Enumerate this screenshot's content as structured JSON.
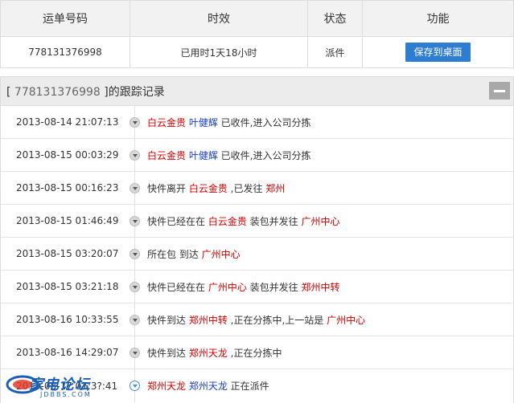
{
  "summary": {
    "headers": [
      "运单号码",
      "时效",
      "状态",
      "功能"
    ],
    "tracking_number": "778131376998",
    "duration": "已用时1天18小时",
    "status": "派件",
    "save_label": "保存到桌面"
  },
  "panel": {
    "title_prefix": "[ ",
    "tracking_number": "778131376998",
    "title_suffix": " ]的跟踪记录"
  },
  "events": [
    {
      "time": "2013-08-14 21:07:13",
      "parts": [
        [
          "red",
          "白云金贵"
        ],
        [
          "blue",
          " 叶健辉"
        ],
        [
          "plain",
          " 已收件,进入公司分拣"
        ]
      ]
    },
    {
      "time": "2013-08-15 00:03:29",
      "parts": [
        [
          "red",
          "白云金贵"
        ],
        [
          "blue",
          " 叶健辉"
        ],
        [
          "plain",
          " 已收件,进入公司分拣"
        ]
      ]
    },
    {
      "time": "2013-08-15 00:16:23",
      "parts": [
        [
          "plain",
          "快件离开 "
        ],
        [
          "red",
          "白云金贵"
        ],
        [
          "plain",
          " ,已发往 "
        ],
        [
          "red",
          "郑州"
        ]
      ]
    },
    {
      "time": "2013-08-15 01:46:49",
      "parts": [
        [
          "plain",
          "快件已经在在 "
        ],
        [
          "red",
          "白云金贵"
        ],
        [
          "plain",
          " 装包并发往 "
        ],
        [
          "red",
          "广州中心"
        ]
      ]
    },
    {
      "time": "2013-08-15 03:20:07",
      "parts": [
        [
          "plain",
          "所在包 到达 "
        ],
        [
          "red",
          "广州中心"
        ]
      ]
    },
    {
      "time": "2013-08-15 03:21:18",
      "parts": [
        [
          "plain",
          "快件已经在在 "
        ],
        [
          "red",
          "广州中心"
        ],
        [
          "plain",
          " 装包并发往 "
        ],
        [
          "red",
          "郑州中转"
        ]
      ]
    },
    {
      "time": "2013-08-16 10:33:55",
      "parts": [
        [
          "plain",
          "快件到达 "
        ],
        [
          "red",
          "郑州中转"
        ],
        [
          "plain",
          " ,正在分拣中,上一站是 "
        ],
        [
          "red",
          "广州中心"
        ]
      ]
    },
    {
      "time": "2013-08-16 14:29:07",
      "parts": [
        [
          "plain",
          "快件到达 "
        ],
        [
          "red",
          "郑州天龙"
        ],
        [
          "plain",
          " ,正在分拣中"
        ]
      ]
    },
    {
      "time": "2013-08-17 07:3?:41",
      "parts": [
        [
          "red",
          "郑州天龙"
        ],
        [
          "blue",
          " 郑州天龙"
        ],
        [
          "plain",
          " 正在派件"
        ]
      ],
      "active": true
    }
  ],
  "watermark": {
    "text": "家电论坛",
    "sub": "JDBBS.COM"
  },
  "colors": {
    "accent_button": "#2e7dd0",
    "highlight_red": "#cc0000",
    "highlight_blue": "#1a3fbf"
  }
}
